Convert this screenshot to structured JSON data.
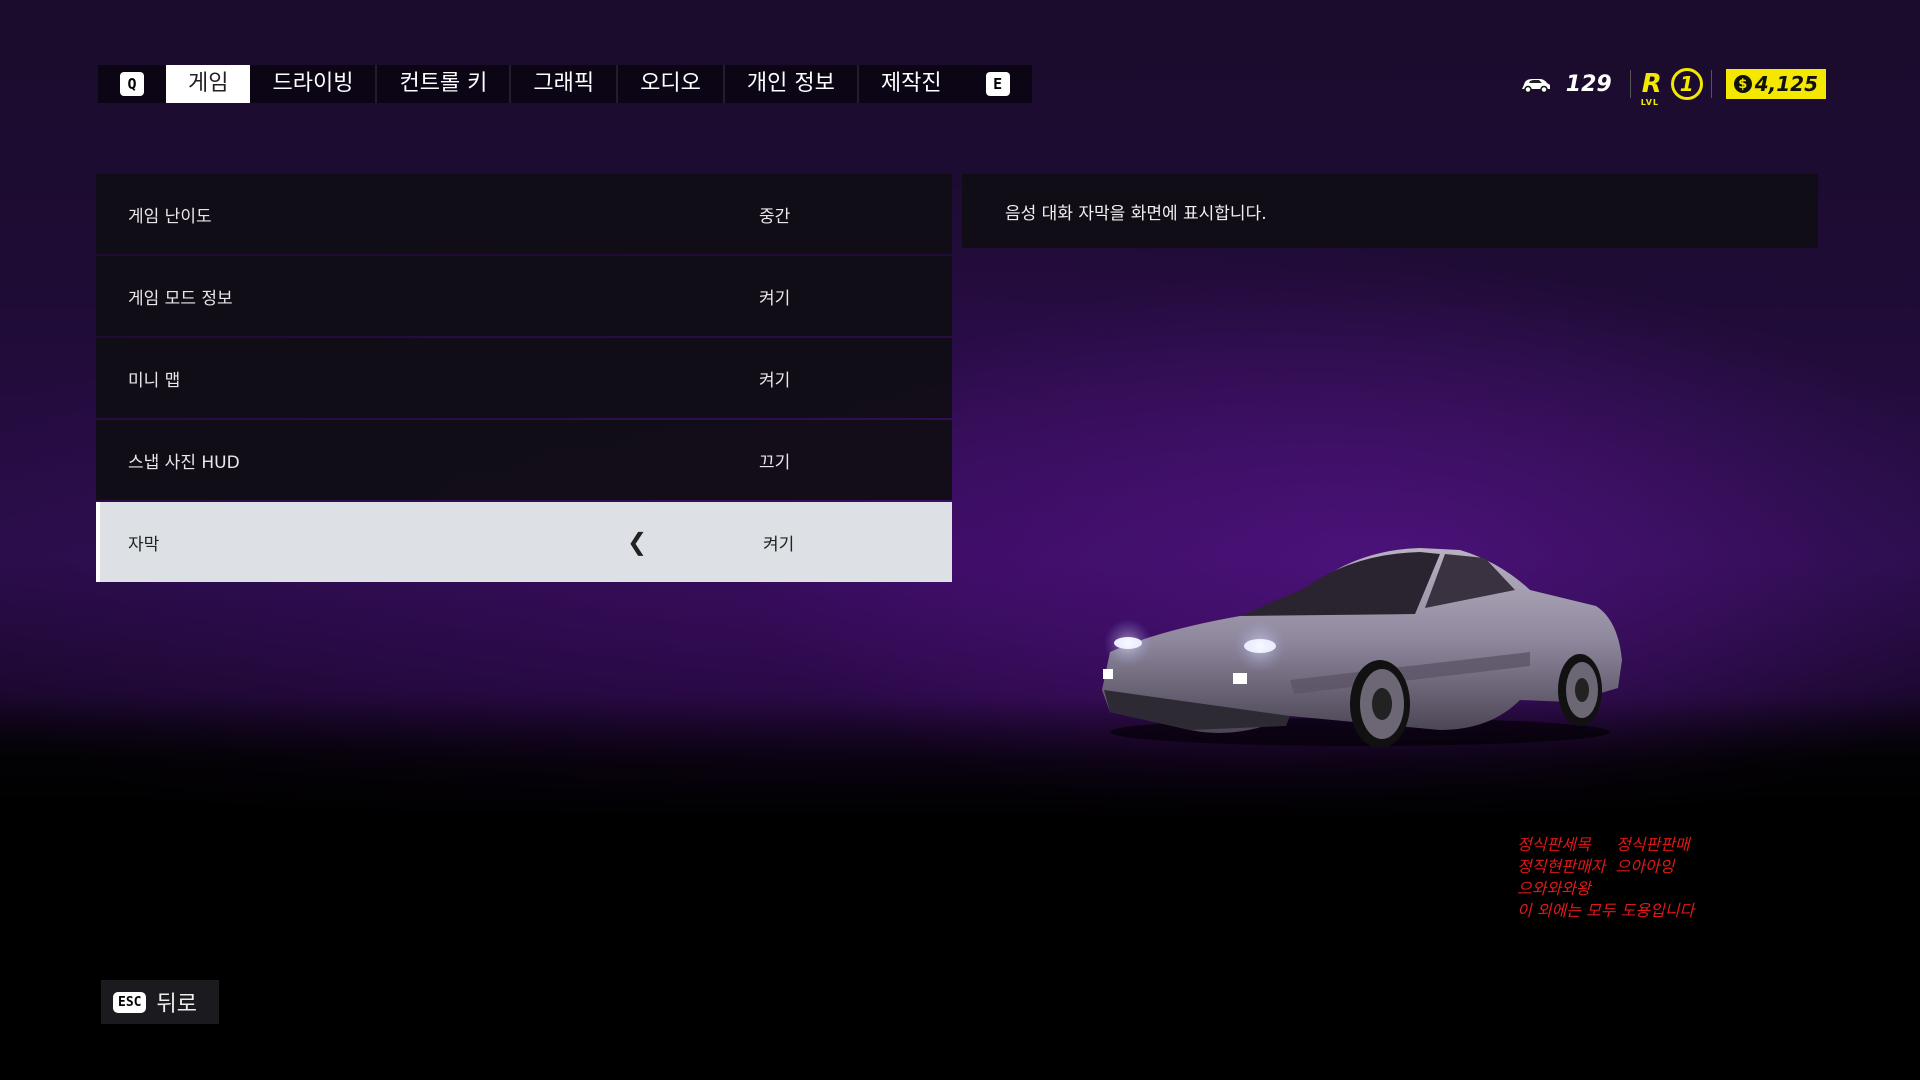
{
  "tabs": {
    "left_key": "Q",
    "right_key": "E",
    "items": [
      {
        "label": "게임",
        "active": true
      },
      {
        "label": "드라이빙",
        "active": false
      },
      {
        "label": "컨트롤 키",
        "active": false
      },
      {
        "label": "그래픽",
        "active": false
      },
      {
        "label": "오디오",
        "active": false
      },
      {
        "label": "개인 정보",
        "active": false
      },
      {
        "label": "제작진",
        "active": false
      }
    ]
  },
  "hud": {
    "car_count": "129",
    "level_letter": "R",
    "level_caption": "LVL",
    "level": "1",
    "money_symbol": "$",
    "money": "4,125",
    "accent_color": "#f5e800"
  },
  "settings": [
    {
      "label": "게임 난이도",
      "value": "중간",
      "selected": false
    },
    {
      "label": "게임 모드 정보",
      "value": "켜기",
      "selected": false
    },
    {
      "label": "미니 맵",
      "value": "켜기",
      "selected": false
    },
    {
      "label": "스냅 사진 HUD",
      "value": "끄기",
      "selected": false
    },
    {
      "label": "자막",
      "value": "켜기",
      "selected": true
    }
  ],
  "description": "음성 대화 자막을 화면에 표시합니다.",
  "overlay_text": [
    "정식판세목     정식판판매",
    "정직현판매자  으아아잉",
    "으와와와왕",
    "이 외에는 모두 도용입니다"
  ],
  "back": {
    "key": "ESC",
    "label": "뒤로"
  }
}
